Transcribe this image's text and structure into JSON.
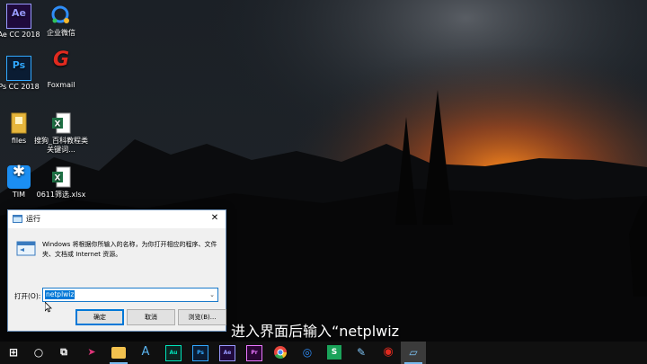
{
  "desktop": {
    "icons": [
      {
        "label": "Ae CC 2018",
        "badge": "Ae",
        "color": "#1f0a3c",
        "accent": "#9999ff"
      },
      {
        "label": "企业微信",
        "badge": "",
        "color": "#ffffff",
        "accent": "#2f8df7"
      },
      {
        "label": "Ps CC 2018",
        "badge": "Ps",
        "color": "#0a1c33",
        "accent": "#31a8ff"
      },
      {
        "label": "Foxmail",
        "badge": "G",
        "color": "#e02a1f",
        "accent": "#ffffff"
      },
      {
        "label": "files",
        "badge": "",
        "color": "#e6b63c",
        "accent": "#ffffff"
      },
      {
        "label": "搜狗_百科教程类关键词...",
        "badge": "X",
        "color": "#1e7145",
        "accent": "#ffffff"
      },
      {
        "label": "TIM",
        "badge": "✱",
        "color": "#1b8ef2",
        "accent": "#ffffff"
      },
      {
        "label": "0611筛选.xlsx",
        "badge": "X",
        "color": "#1e7145",
        "accent": "#ffffff"
      }
    ]
  },
  "run_dialog": {
    "title": "运行",
    "close_glyph": "✕",
    "description": "Windows 将根据你所输入的名称，为你打开相应的程序、文件夹、文档或 Internet 资源。",
    "open_label": "打开(O):",
    "input_value": "netplwiz",
    "dropdown_glyph": "⌄",
    "ok_label": "确定",
    "cancel_label": "取消",
    "browse_label": "浏览(B)..."
  },
  "subtitle": "进入界面后输入“netplwiz",
  "taskbar": {
    "items": [
      {
        "name": "start-button",
        "glyph": "⊞",
        "color": "#ffffff",
        "bg": ""
      },
      {
        "name": "cortana-button",
        "glyph": "○",
        "color": "#ffffff",
        "bg": ""
      },
      {
        "name": "task-view-button",
        "glyph": "⧉",
        "color": "#ffffff",
        "bg": ""
      },
      {
        "name": "taskbar-app-pointer",
        "glyph": "➤",
        "color": "#e0357a",
        "bg": ""
      },
      {
        "name": "taskbar-file-explorer",
        "glyph": "",
        "color": "#ffffff",
        "bg": "#f2c14e"
      },
      {
        "name": "taskbar-app-a",
        "glyph": "A",
        "color": "#5ab4f0",
        "bg": ""
      },
      {
        "name": "taskbar-audition",
        "glyph": "Au",
        "color": "#00e4bb",
        "bg": "#0c2622"
      },
      {
        "name": "taskbar-photoshop",
        "glyph": "Ps",
        "color": "#31a8ff",
        "bg": "#0a1c33"
      },
      {
        "name": "taskbar-after-effects",
        "glyph": "Ae",
        "color": "#9999ff",
        "bg": "#1f0a3c"
      },
      {
        "name": "taskbar-premiere",
        "glyph": "Pr",
        "color": "#ea77ff",
        "bg": "#2a0634"
      },
      {
        "name": "taskbar-chrome",
        "glyph": "●",
        "color": "#e8453c",
        "bg": ""
      },
      {
        "name": "taskbar-wecom",
        "glyph": "◎",
        "color": "#2f8df7",
        "bg": ""
      },
      {
        "name": "taskbar-wps-sheet",
        "glyph": "S",
        "color": "#ffffff",
        "bg": "#1aa35a"
      },
      {
        "name": "taskbar-app-pen",
        "glyph": "✎",
        "color": "#7fc4f5",
        "bg": ""
      },
      {
        "name": "taskbar-app-record",
        "glyph": "◉",
        "color": "#e02a1f",
        "bg": ""
      },
      {
        "name": "taskbar-run",
        "glyph": "▱",
        "color": "#7fc4f5",
        "bg": ""
      }
    ]
  }
}
